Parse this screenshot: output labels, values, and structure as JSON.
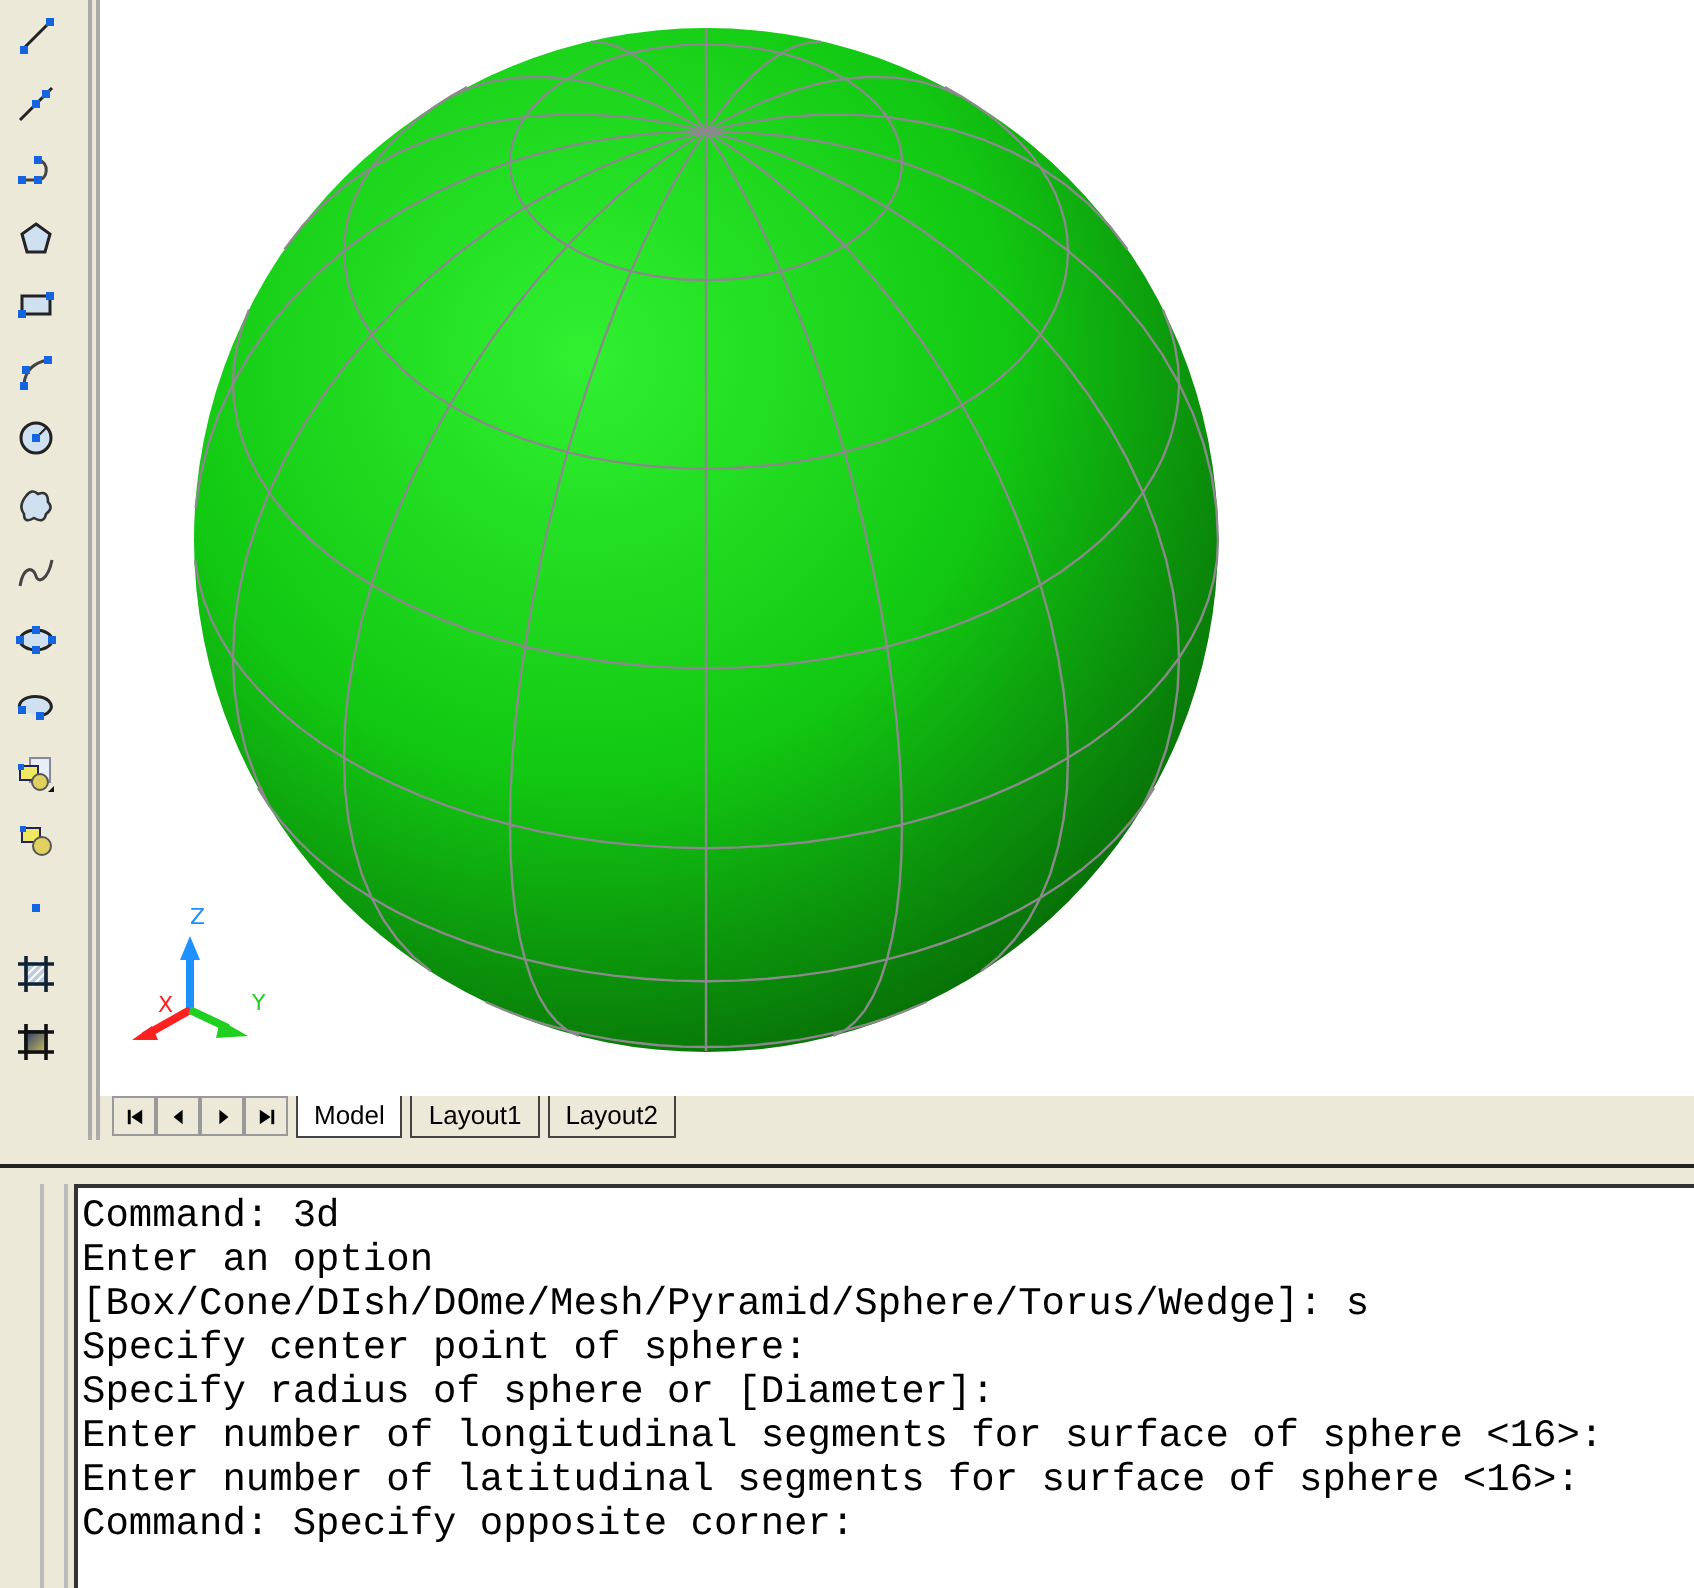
{
  "viewport": {
    "ucs_axes": [
      {
        "label": "Z",
        "color": "#1e90ff"
      },
      {
        "label": "X",
        "color": "#ff2020"
      },
      {
        "label": "Y",
        "color": "#20d020"
      }
    ]
  },
  "layout_tabs": [
    {
      "label": "Model",
      "selected": true
    },
    {
      "label": "Layout1",
      "selected": false
    },
    {
      "label": "Layout2",
      "selected": false
    }
  ],
  "command_history": [
    "Command: 3d",
    "Enter an option",
    "[Box/Cone/DIsh/DOme/Mesh/Pyramid/Sphere/Torus/Wedge]: s",
    "Specify center point of sphere:",
    "Specify radius of sphere or [Diameter]:",
    "Enter number of longitudinal segments for surface of sphere <16>:",
    "Enter number of latitudinal segments for surface of sphere <16>:",
    "Command: Specify opposite corner:"
  ]
}
